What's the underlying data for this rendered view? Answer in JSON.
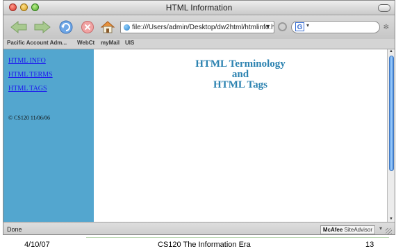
{
  "window": {
    "title": "HTML Information"
  },
  "toolbar": {
    "address": "file:///Users/admin/Desktop/dw2html/htmlinfo.h",
    "address_dropdown": "▼",
    "search_engine_letter": "G",
    "search_caret": "▾"
  },
  "bookmarks": [
    "Pacific Account Adm...",
    "WebCt",
    "myMail",
    "UIS"
  ],
  "sidebar": {
    "links": [
      "HTML INFO",
      "HTML TERMS",
      "HTML TAGS"
    ],
    "copyright": "© CS120 11/06/06"
  },
  "main": {
    "heading_lines": [
      "HTML Terminology",
      "and",
      "HTML Tags"
    ]
  },
  "status": {
    "text": "Done",
    "mcafee_brand": "McAfee",
    "mcafee_product": "SiteAdvisor",
    "mcafee_caret": "▾"
  },
  "slide_footer": {
    "date": "4/10/07",
    "course": "CS120 The Information Era",
    "page": "13"
  },
  "colors": {
    "sidebar_bg": "#53a6cf",
    "link": "#1d1aef",
    "heading": "#2b82b0"
  }
}
